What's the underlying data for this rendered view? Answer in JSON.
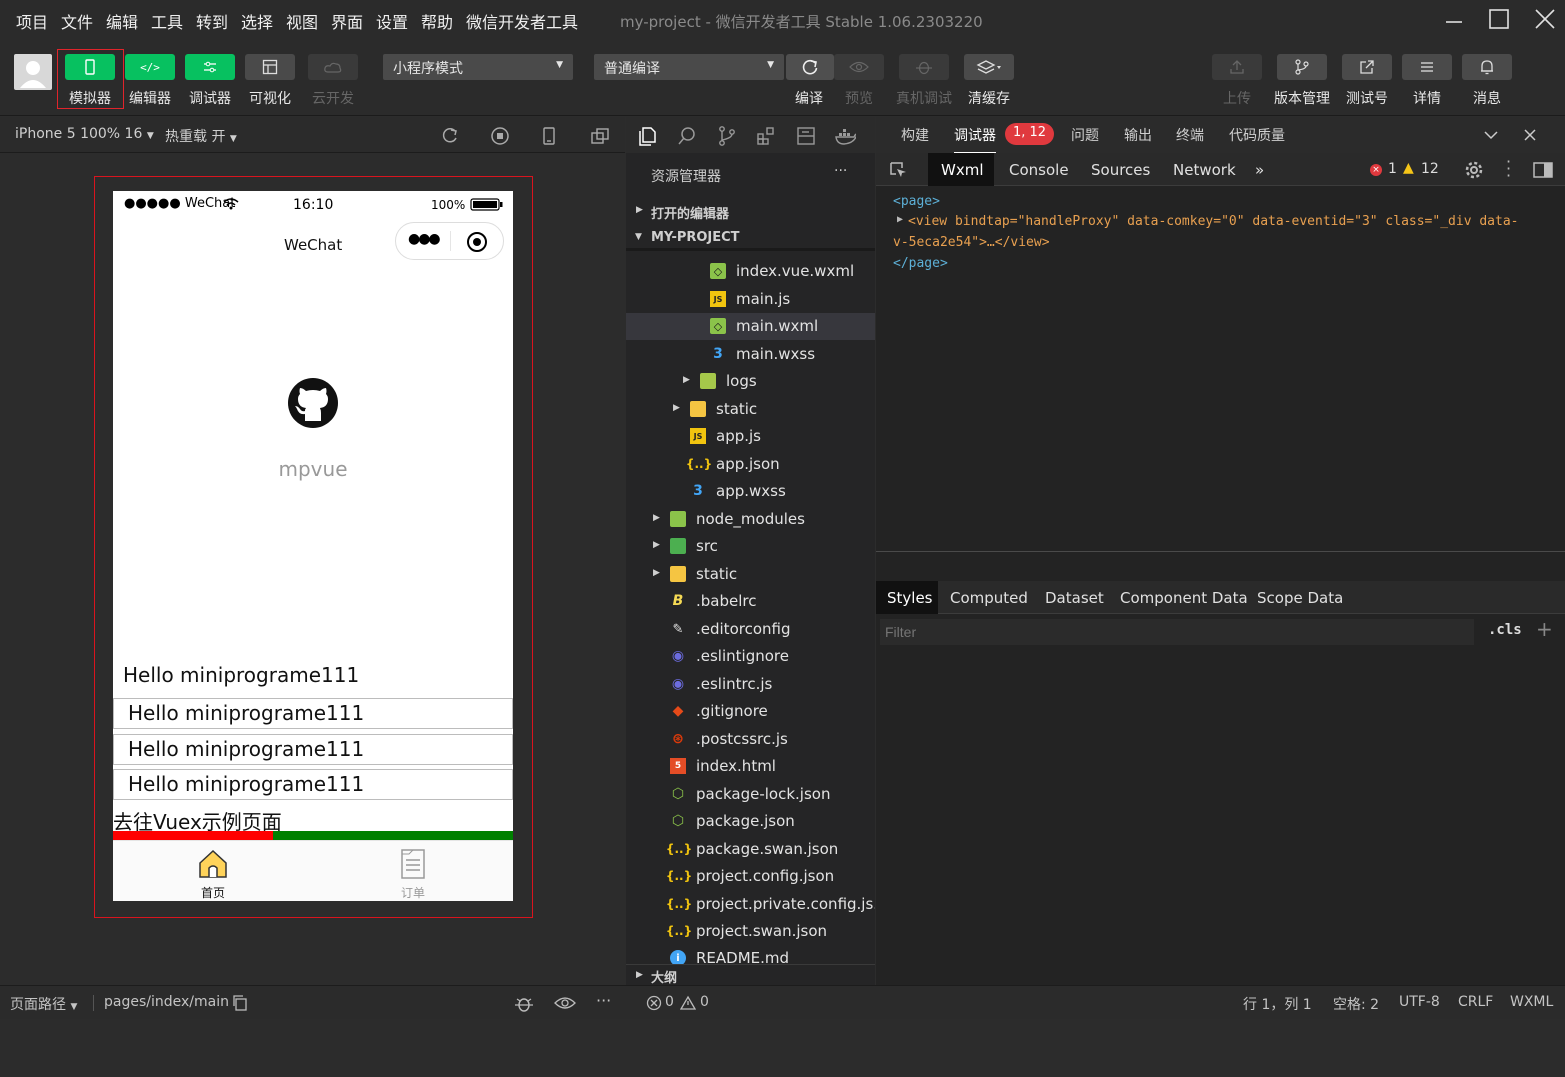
{
  "menu": {
    "items": [
      "项目",
      "文件",
      "编辑",
      "工具",
      "转到",
      "选择",
      "视图",
      "界面",
      "设置",
      "帮助",
      "微信开发者工具"
    ],
    "title": "my-project - 微信开发者工具 Stable 1.06.2303220"
  },
  "toolbar": {
    "simulator": "模拟器",
    "editor": "编辑器",
    "debugger": "调试器",
    "visual": "可视化",
    "cloud": "云开发",
    "mode_select": "小程序模式",
    "compile_select": "普通编译",
    "compile": "编译",
    "preview": "预览",
    "real_debug": "真机调试",
    "clear_cache": "清缓存",
    "upload": "上传",
    "version": "版本管理",
    "test_account": "测试号",
    "details": "详情",
    "messages": "消息"
  },
  "simbar": {
    "device": "iPhone 5 100% 16",
    "hot_reload": "热重载 开"
  },
  "phone": {
    "carrier": "●●●●● WeChat",
    "time": "16:10",
    "battery": "100%",
    "nav_title": "WeChat",
    "app_name": "mpvue",
    "hello_plain": "Hello miniprograme111",
    "hello_rows": [
      "Hello miniprograme111",
      "Hello miniprograme111",
      "Hello miniprograme111"
    ],
    "link": "去往Vuex示例页面",
    "tabs": [
      "首页",
      "订单"
    ]
  },
  "explorer": {
    "header": "资源管理器",
    "more": "···",
    "open_editors": "打开的编辑器",
    "project": "MY-PROJECT",
    "outline": "大纲",
    "files": [
      {
        "name": "index.vue.wxml"
      },
      {
        "name": "main.js"
      },
      {
        "name": "main.wxml"
      },
      {
        "name": "main.wxss"
      },
      {
        "name": "logs"
      },
      {
        "name": "static"
      },
      {
        "name": "app.js"
      },
      {
        "name": "app.json"
      },
      {
        "name": "app.wxss"
      },
      {
        "name": "node_modules"
      },
      {
        "name": "src"
      },
      {
        "name": "static"
      },
      {
        "name": ".babelrc"
      },
      {
        "name": ".editorconfig"
      },
      {
        "name": ".eslintignore"
      },
      {
        "name": ".eslintrc.js"
      },
      {
        "name": ".gitignore"
      },
      {
        "name": ".postcssrc.js"
      },
      {
        "name": "index.html"
      },
      {
        "name": "package-lock.json"
      },
      {
        "name": "package.json"
      },
      {
        "name": "package.swan.json"
      },
      {
        "name": "project.config.json"
      },
      {
        "name": "project.private.config.js..."
      },
      {
        "name": "project.swan.json"
      },
      {
        "name": "README.md"
      }
    ]
  },
  "devtools": {
    "top_tabs": [
      "构建",
      "调试器",
      "问题",
      "输出",
      "终端",
      "代码质量"
    ],
    "badge": "1, 12",
    "panel_tabs": [
      "Wxml",
      "Console",
      "Sources",
      "Network"
    ],
    "more": "»",
    "errors": "1",
    "warnings": "12",
    "code_line1": "<page>",
    "code_line2": "<view bindtap=\"handleProxy\" data-comkey=\"0\" data-eventid=\"3\" class=\"_div data-",
    "code_line3": "v-5eca2e54\">…</view>",
    "code_line4": "</page>",
    "style_tabs": [
      "Styles",
      "Computed",
      "Dataset",
      "Component Data",
      "Scope Data"
    ],
    "filter_placeholder": "Filter",
    "cls": ".cls",
    "plus": "+"
  },
  "status": {
    "page_path_label": "页面路径",
    "page_path": "pages/index/main",
    "errors": "0",
    "warnings": "0",
    "position": "行 1，列 1",
    "spaces": "空格: 2",
    "encoding": "UTF-8",
    "eol": "CRLF",
    "language": "WXML"
  }
}
